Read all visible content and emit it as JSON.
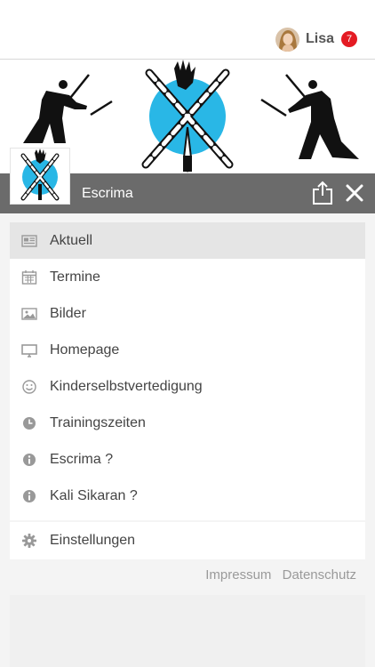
{
  "header": {
    "user_name": "Lisa",
    "notification_count": "7"
  },
  "group": {
    "title": "Escrima"
  },
  "menu": {
    "items": [
      {
        "label": "Aktuell",
        "icon": "newspaper-icon",
        "active": true
      },
      {
        "label": "Termine",
        "icon": "calendar-icon"
      },
      {
        "label": "Bilder",
        "icon": "image-icon"
      },
      {
        "label": "Homepage",
        "icon": "monitor-icon"
      },
      {
        "label": "Kinderselbstvertedigung",
        "icon": "smiley-icon"
      },
      {
        "label": "Trainingszeiten",
        "icon": "clock-icon"
      },
      {
        "label": "Escrima ?",
        "icon": "info-icon"
      },
      {
        "label": "Kali Sikaran ?",
        "icon": "info-icon"
      }
    ],
    "settings_label": "Einstellungen"
  },
  "footer": {
    "impressum": "Impressum",
    "datenschutz": "Datenschutz"
  },
  "colors": {
    "titlebar": "#6b6b6b",
    "badge": "#e41b23",
    "logo_circle": "#29b7e6",
    "active_item": "#e5e5e5"
  }
}
